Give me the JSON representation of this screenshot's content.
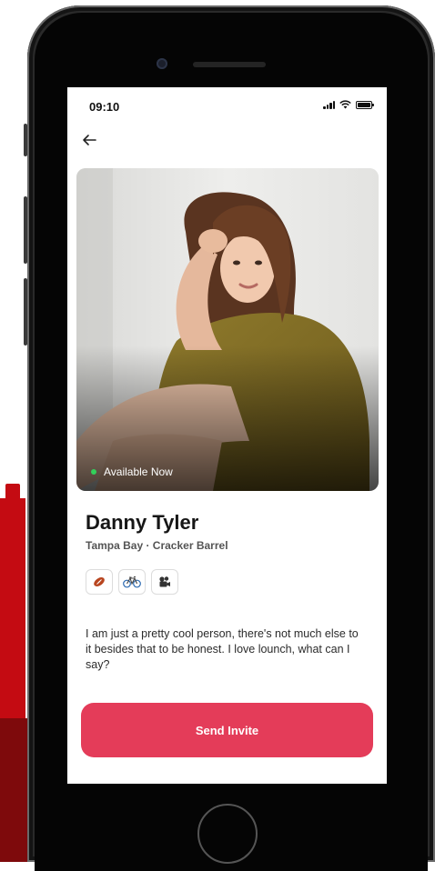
{
  "status_bar": {
    "time": "09:10"
  },
  "profile": {
    "availability": "Available Now",
    "name": "Danny Tyler",
    "location": "Tampa Bay · Cracker Barrel",
    "interests": [
      {
        "icon": "football-icon"
      },
      {
        "icon": "bicycle-icon"
      },
      {
        "icon": "movie-camera-icon"
      }
    ],
    "bio": "I am just a pretty cool person, there's not much else to it besides that to be honest. I love lounch, what can I say?"
  },
  "actions": {
    "send_invite_label": "Send Invite"
  },
  "colors": {
    "accent": "#e43c59",
    "available": "#33d05a",
    "background_red": "#c40b12"
  }
}
